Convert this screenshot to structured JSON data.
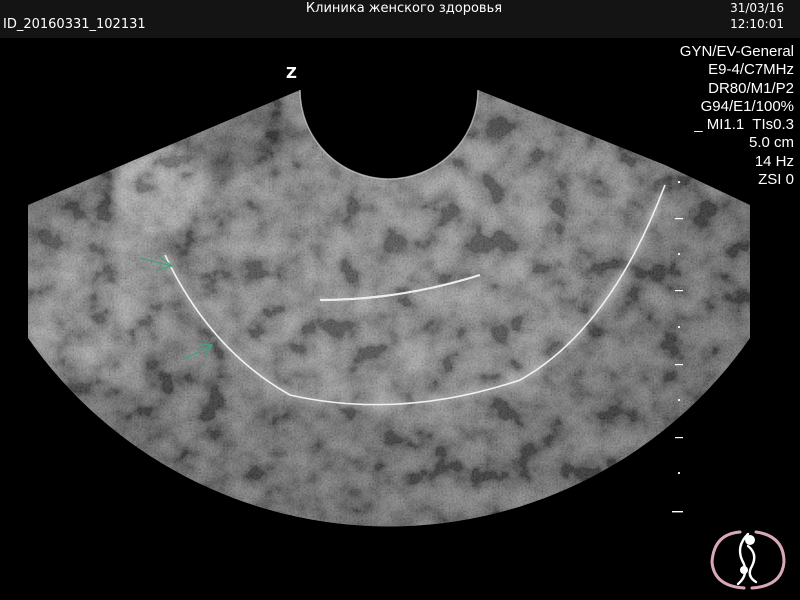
{
  "header": {
    "clinic_name": "Клиника женского здоровья",
    "patient_id": "ID_20160331_102131",
    "date": "31/03/16",
    "time": "12:10:01"
  },
  "scan_params": [
    "GYN/EV-General",
    "E9-4/C7MHz",
    "DR80/M1/P2",
    "G94/E1/100%",
    "_ MI1.1  TIs0.3",
    "5.0 cm",
    "14 Hz",
    "ZSI 0"
  ],
  "orientation_marker": "Z",
  "annotation_color": "#4aa07a",
  "icons": [
    "focus-marker-icon",
    "clinic-logo-icon",
    "arrow-icon"
  ]
}
